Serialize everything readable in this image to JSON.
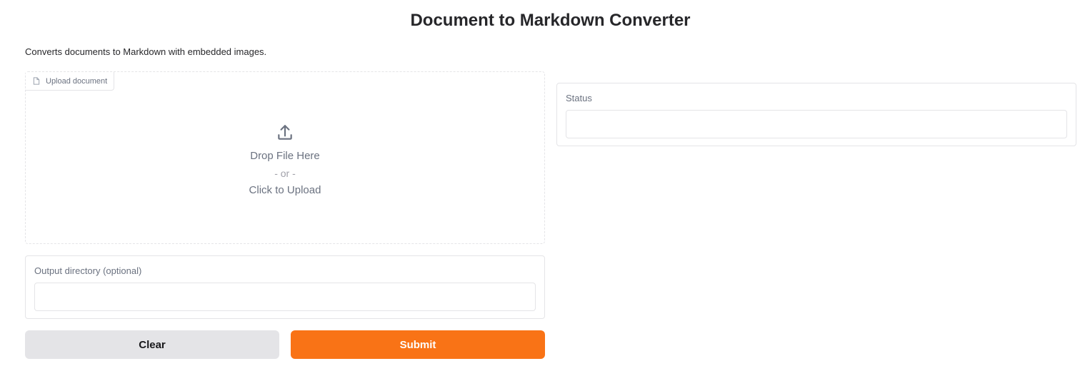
{
  "header": {
    "title": "Document to Markdown Converter",
    "description": "Converts documents to Markdown with embedded images."
  },
  "upload": {
    "label": "Upload document",
    "label_icon": "file-icon",
    "icon": "upload-icon",
    "drop_text": "Drop File Here",
    "or_text": "- or -",
    "click_text": "Click to Upload"
  },
  "output_directory": {
    "label": "Output directory (optional)",
    "value": "",
    "placeholder": ""
  },
  "status": {
    "label": "Status",
    "value": ""
  },
  "buttons": {
    "clear_label": "Clear",
    "submit_label": "Submit"
  },
  "colors": {
    "accent": "#f97316",
    "secondary_button": "#e4e4e7",
    "border": "#e4e4e7",
    "muted_text": "#6b7280"
  }
}
